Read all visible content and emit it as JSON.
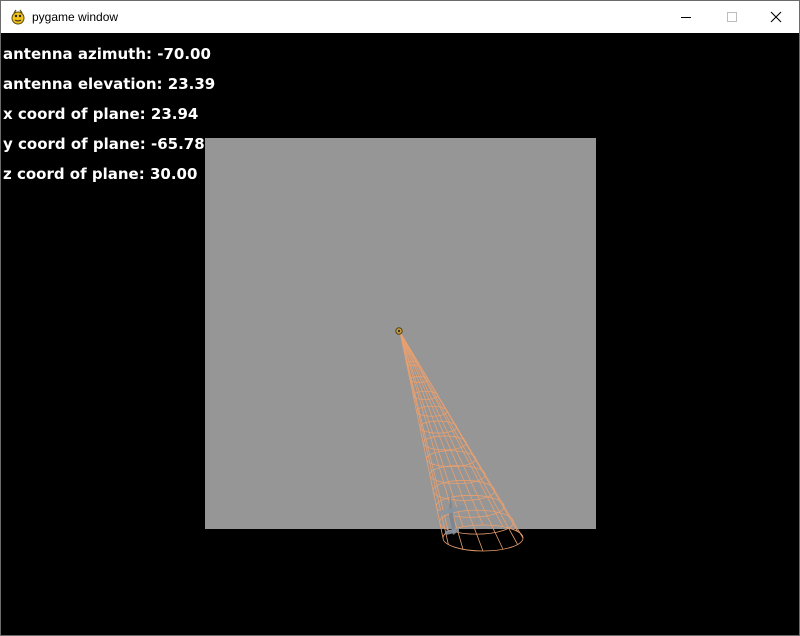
{
  "window": {
    "title": "pygame window",
    "icon": "pygame-snake-icon",
    "controls": {
      "minimize_icon": "minimize-icon",
      "maximize_icon": "maximize-icon",
      "close_icon": "close-icon"
    }
  },
  "hud": {
    "azimuth": "antenna azimuth: -70.00",
    "elevation": "antenna elevation: 23.39",
    "x_coord": "x coord of plane: 23.94",
    "y_coord": "y coord of plane: -65.78",
    "z_coord": "z coord of plane: 30.00"
  },
  "scene": {
    "background_color": "#000000",
    "ground_color": "#969696",
    "beam_color": "#e8a070",
    "plane_color": "#7a8590",
    "antenna_color": "#c8a040"
  }
}
